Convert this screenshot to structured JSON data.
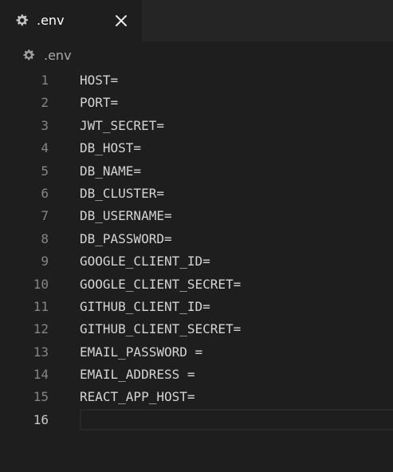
{
  "tab": {
    "icon": "gear-icon",
    "label": ".env",
    "close_icon": "close-icon"
  },
  "breadcrumb": {
    "icon": "gear-icon",
    "label": ".env"
  },
  "lines": [
    {
      "number": "1",
      "text": "HOST="
    },
    {
      "number": "2",
      "text": "PORT="
    },
    {
      "number": "3",
      "text": "JWT_SECRET="
    },
    {
      "number": "4",
      "text": "DB_HOST="
    },
    {
      "number": "5",
      "text": "DB_NAME="
    },
    {
      "number": "6",
      "text": "DB_CLUSTER="
    },
    {
      "number": "7",
      "text": "DB_USERNAME="
    },
    {
      "number": "8",
      "text": "DB_PASSWORD="
    },
    {
      "number": "9",
      "text": "GOOGLE_CLIENT_ID="
    },
    {
      "number": "10",
      "text": "GOOGLE_CLIENT_SECRET="
    },
    {
      "number": "11",
      "text": "GITHUB_CLIENT_ID="
    },
    {
      "number": "12",
      "text": "GITHUB_CLIENT_SECRET="
    },
    {
      "number": "13",
      "text": "EMAIL_PASSWORD =",
      "whitespace_marker": true
    },
    {
      "number": "14",
      "text": "EMAIL_ADDRESS =",
      "whitespace_marker": true
    },
    {
      "number": "15",
      "text": "REACT_APP_HOST="
    },
    {
      "number": "16",
      "text": "",
      "active": true
    }
  ],
  "colors": {
    "editor_bg": "#1e1e1e",
    "tabbar_bg": "#252526",
    "line_number": "#858585",
    "active_line_number": "#c6c6c6",
    "text": "#d4d4d4"
  }
}
